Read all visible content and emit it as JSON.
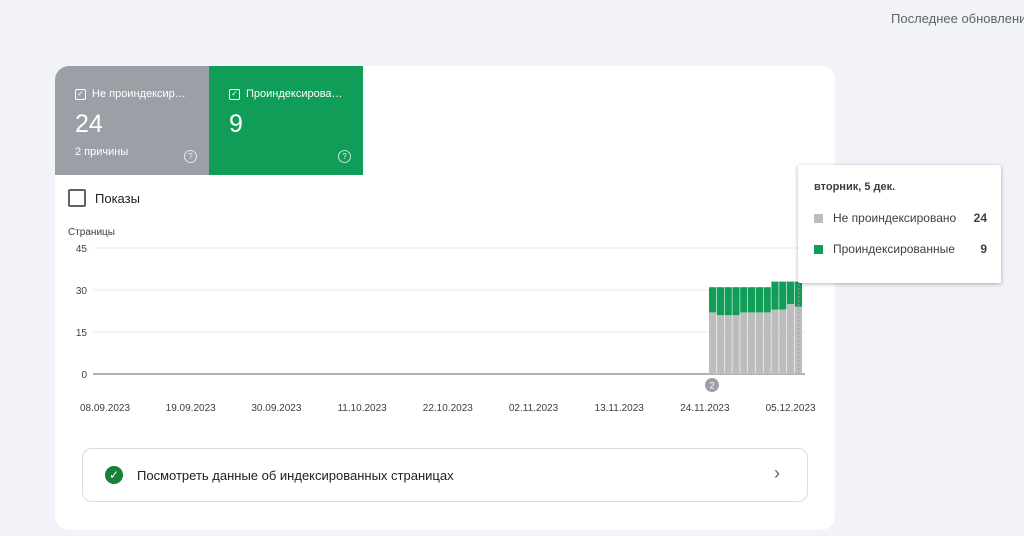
{
  "header": {
    "last_update_label": "Последнее обновлени"
  },
  "tiles": [
    {
      "label": "Не проиндексир…",
      "value": "24",
      "sub": "2 причины",
      "color": "#9aa0a6"
    },
    {
      "label": "Проиндексирова…",
      "value": "9",
      "sub": "",
      "color": "#0f9d58"
    }
  ],
  "toggle": {
    "label": "Показы"
  },
  "annotation": {
    "text": "2"
  },
  "chart_data": {
    "type": "bar",
    "stacked": true,
    "ylabel": "Страницы",
    "ylim": [
      0,
      45
    ],
    "yticks": [
      "0",
      "15",
      "30",
      "45"
    ],
    "xticks": [
      "08.09.2023",
      "19.09.2023",
      "30.09.2023",
      "11.10.2023",
      "22.10.2023",
      "02.11.2023",
      "13.11.2023",
      "24.11.2023",
      "05.12.2023"
    ],
    "categories": [
      "24.11.2023",
      "25.11.2023",
      "26.11.2023",
      "27.11.2023",
      "28.11.2023",
      "29.11.2023",
      "30.11.2023",
      "01.12.2023",
      "02.12.2023",
      "03.12.2023",
      "04.12.2023",
      "05.12.2023"
    ],
    "series": [
      {
        "name": "Не проиндексировано",
        "color": "#bdbdbd",
        "values": [
          22,
          21,
          21,
          21,
          22,
          22,
          22,
          22,
          23,
          23,
          25,
          24
        ]
      },
      {
        "name": "Проиндексированные",
        "color": "#0f9d58",
        "values": [
          9,
          10,
          10,
          10,
          9,
          9,
          9,
          9,
          10,
          10,
          8,
          9
        ]
      }
    ],
    "grid": true,
    "legend": "none"
  },
  "index_link": {
    "label": "Посмотреть данные об индексированных страницах"
  },
  "tooltip": {
    "title": "вторник, 5 дек.",
    "rows": [
      {
        "label": "Не проиндексировано",
        "value": "24",
        "color": "#bdbdbd"
      },
      {
        "label": "Проиндексированные",
        "value": "9",
        "color": "#0f9d58"
      }
    ]
  }
}
